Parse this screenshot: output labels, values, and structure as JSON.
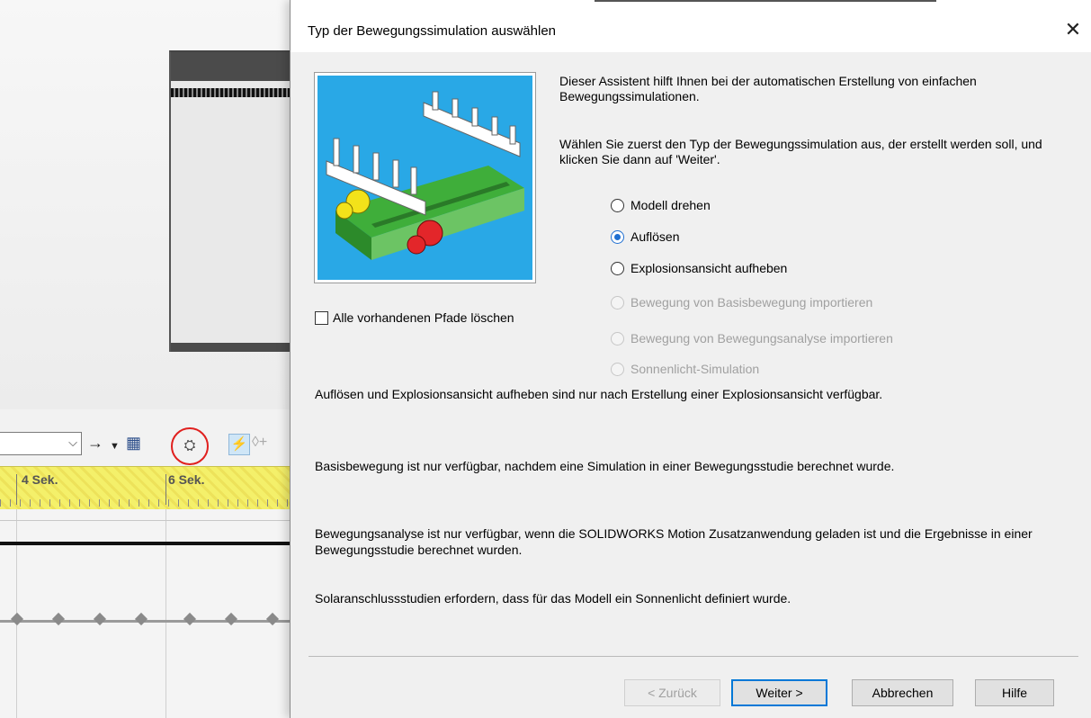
{
  "background": {
    "timeline_labels": [
      "4 Sek.",
      "6 Sek."
    ],
    "toolbar_icons": [
      "dropdown-chevron-icon",
      "arrow-right-icon",
      "dropdown-arrow-icon",
      "save-animation-icon",
      "motion-study-wizard-icon",
      "calculate-icon",
      "add-key-icon"
    ],
    "highlight_color": "#e0201e",
    "timeline_color": "#f4f06a"
  },
  "dialog": {
    "title": "Typ der Bewegungssimulation auswählen",
    "intro": "Dieser Assistent hilft Ihnen bei der automatischen Erstellung von einfachen Bewegungssimulationen.",
    "instruction": "Wählen Sie zuerst den Typ der Bewegungssimulation aus, der erstellt werden soll, und klicken Sie dann auf 'Weiter'.",
    "options": [
      {
        "label": "Modell drehen",
        "checked": false,
        "enabled": true
      },
      {
        "label": "Auflösen",
        "checked": true,
        "enabled": true
      },
      {
        "label": "Explosionsansicht aufheben",
        "checked": false,
        "enabled": true
      },
      {
        "label": "Bewegung von Basisbewegung importieren",
        "checked": false,
        "enabled": false
      },
      {
        "label": "Bewegung von Bewegungsanalyse importieren",
        "checked": false,
        "enabled": false
      },
      {
        "label": "Sonnenlicht-Simulation",
        "checked": false,
        "enabled": false
      }
    ],
    "checkbox_label": "Alle vorhandenen Pfade löschen",
    "notes": [
      "Auflösen und Explosionsansicht aufheben sind nur nach Erstellung einer Explosionsansicht verfügbar.",
      "Basisbewegung ist nur verfügbar, nachdem eine Simulation in einer Bewegungsstudie berechnet wurde.",
      "Bewegungsanalyse ist nur verfügbar, wenn die SOLIDWORKS Motion Zusatzanwendung geladen ist und die Ergebnisse in einer Bewegungsstudie berechnet wurden.",
      "Solaranschlussstudien erfordern, dass für das Modell ein Sonnenlicht definiert wurde."
    ],
    "buttons": {
      "back": "< Zurück",
      "next": "Weiter >",
      "cancel": "Abbrechen",
      "help": "Hilfe"
    },
    "accent_color": "#0078d7"
  }
}
